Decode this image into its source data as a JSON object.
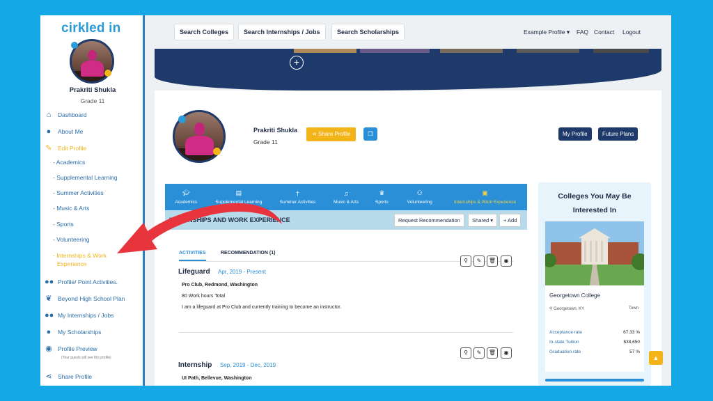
{
  "sidebar": {
    "logo": "cirkled in",
    "name": "Prakriti Shukla",
    "grade": "Grade 11",
    "items": [
      {
        "label": "Dashboard",
        "icon": "home-icon"
      },
      {
        "label": "About Me",
        "icon": "user-icon"
      },
      {
        "label": "Edit Profile",
        "icon": "edit-icon"
      },
      {
        "label": "- Academics"
      },
      {
        "label": "- Supplemental Learning"
      },
      {
        "label": "- Summer Activities"
      },
      {
        "label": "- Music & Arts"
      },
      {
        "label": "- Sports"
      },
      {
        "label": "- Volunteering"
      },
      {
        "label": "- Internships & Work",
        "label2": "Experience"
      },
      {
        "label": "Profile/ Point Activities.",
        "icon": "users-icon"
      },
      {
        "label": "Beyond High School Plan",
        "icon": "leaf-icon"
      },
      {
        "label": "My Internships / Jobs",
        "icon": "users-icon"
      },
      {
        "label": "My Scholarships",
        "icon": "user-icon"
      },
      {
        "label": "Profile Preview",
        "icon": "eye-icon"
      },
      {
        "label": "Share Profile",
        "icon": "share-icon"
      }
    ],
    "preview_note": "(Your guests will see this profile)"
  },
  "topbar": {
    "buttons": [
      "Search Colleges",
      "Search Internships / Jobs",
      "Search Scholarships"
    ],
    "links": [
      "Example Profile",
      "FAQ",
      "Contact",
      "Logout"
    ]
  },
  "profile": {
    "name": "Prakriti Shukla",
    "grade": "Grade 11",
    "share_label": "Share Profile",
    "my_profile": "My Profile",
    "future_plans": "Future Plans"
  },
  "categories": [
    "Academics",
    "Supplemental Learning",
    "Summer Activities",
    "Music & Arts",
    "Sports",
    "Volunteering",
    "Internships & Work Experience"
  ],
  "section": {
    "title": "INTERNSHIPS AND WORK EXPERIENCE",
    "request": "Request Recommendation",
    "shared": "Shared",
    "add": "+ Add"
  },
  "tabs": [
    "ACTIVITIES",
    "RECOMMENDATION (1)"
  ],
  "entries": [
    {
      "title": "Lifeguard",
      "date": "Apr, 2019 - Present",
      "org": "Pro Club, Redmond, Washington",
      "hours": "80 Work hours Total",
      "desc": "I am a lifeguard at Pro Club and currently training to become an instructor."
    },
    {
      "title": "Internship",
      "date": "Sep, 2019 - Dec, 2019",
      "org": "UI Path, Bellevue, Washington"
    }
  ],
  "colleges": {
    "heading1": "Colleges You May Be",
    "heading2": "Interested In",
    "name": "Georgetown College",
    "location": "Georgetown, KY",
    "type": "Town",
    "stats": [
      {
        "label": "Acceptance rate",
        "value": "67.33 %"
      },
      {
        "label": "In-state Tuition",
        "value": "$38,650"
      },
      {
        "label": "Graduation rate",
        "value": "57 %"
      }
    ]
  },
  "colors": {
    "accent": "#2a8fd6",
    "navy": "#1e3a6b",
    "yellow": "#f2b418",
    "arrow": "#e8343c"
  }
}
